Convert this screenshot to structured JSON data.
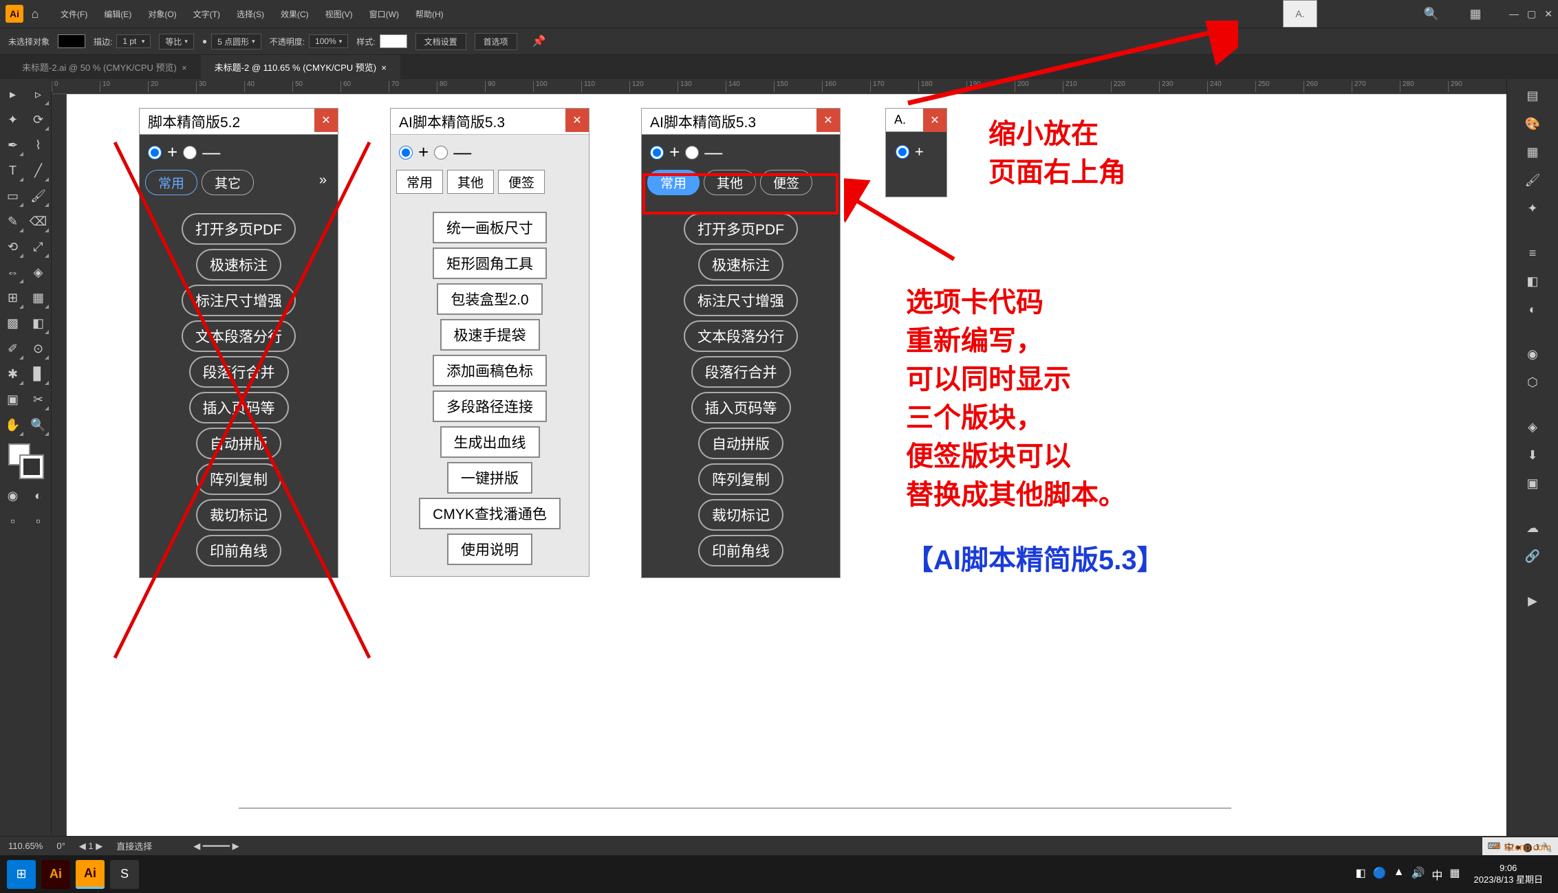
{
  "menu": {
    "file": "文件(F)",
    "edit": "编辑(E)",
    "object": "对象(O)",
    "type": "文字(T)",
    "select": "选择(S)",
    "effect": "效果(C)",
    "view": "视图(V)",
    "window": "窗口(W)",
    "help": "帮助(H)"
  },
  "optbar": {
    "noSelection": "未选择对象",
    "stroke": "描边:",
    "strokeVal": "1 pt",
    "uniform": "等比",
    "ptRound": "5 点圆形",
    "opacity": "不透明度:",
    "opacityVal": "100%",
    "style": "样式:",
    "docSetup": "文档设置",
    "prefs": "首选项"
  },
  "tabs": {
    "t1": "未标题-2.ai @ 50 % (CMYK/CPU 预览)",
    "t2": "未标题-2 @ 110.65 % (CMYK/CPU 预览)"
  },
  "status": {
    "zoom": "110.65%",
    "angle": "0°",
    "nav": "1",
    "tool": "直接选择"
  },
  "clock": {
    "time": "9:06",
    "date": "2023/8/13 星期日"
  },
  "panel52": {
    "title": "脚本精简版5.2",
    "tabs": [
      "常用",
      "其它"
    ],
    "btns": [
      "打开多页PDF",
      "极速标注",
      "标注尺寸增强",
      "文本段落分行",
      "段落行合并",
      "插入页码等",
      "自动拼版",
      "阵列复制",
      "裁切标记",
      "印前角线"
    ]
  },
  "panel53light": {
    "title": "AI脚本精简版5.3",
    "tabs": [
      "常用",
      "其他",
      "便签"
    ],
    "btns": [
      "统一画板尺寸",
      "矩形圆角工具",
      "包装盒型2.0",
      "极速手提袋",
      "添加画稿色标",
      "多段路径连接",
      "生成出血线",
      "一键拼版",
      "CMYK查找潘通色",
      "使用说明"
    ]
  },
  "panel53dark": {
    "title": "AI脚本精简版5.3",
    "tabs": [
      "常用",
      "其他",
      "便签"
    ],
    "btns": [
      "打开多页PDF",
      "极速标注",
      "标注尺寸增强",
      "文本段落分行",
      "段落行合并",
      "插入页码等",
      "自动拼版",
      "阵列复制",
      "裁切标记",
      "印前角线"
    ]
  },
  "mini": {
    "title": "A."
  },
  "anno": {
    "top1": "缩小放在",
    "top2": "页面右上角",
    "l1": "选项卡代码",
    "l2": "重新编写，",
    "l3": "可以同时显示",
    "l4": "三个版块，",
    "l5": "便签版块可以",
    "l6": "替换成其他脚本。",
    "final": "【AI脚本精简版5.3】"
  },
  "ob": "A.",
  "ruler": [
    "0",
    "10",
    "20",
    "30",
    "40",
    "50",
    "60",
    "70",
    "80",
    "90",
    "100",
    "110",
    "120",
    "130",
    "140",
    "150",
    "160",
    "170",
    "180",
    "190",
    "200",
    "210",
    "220",
    "230",
    "240",
    "250",
    "260",
    "270",
    "280",
    "290"
  ]
}
